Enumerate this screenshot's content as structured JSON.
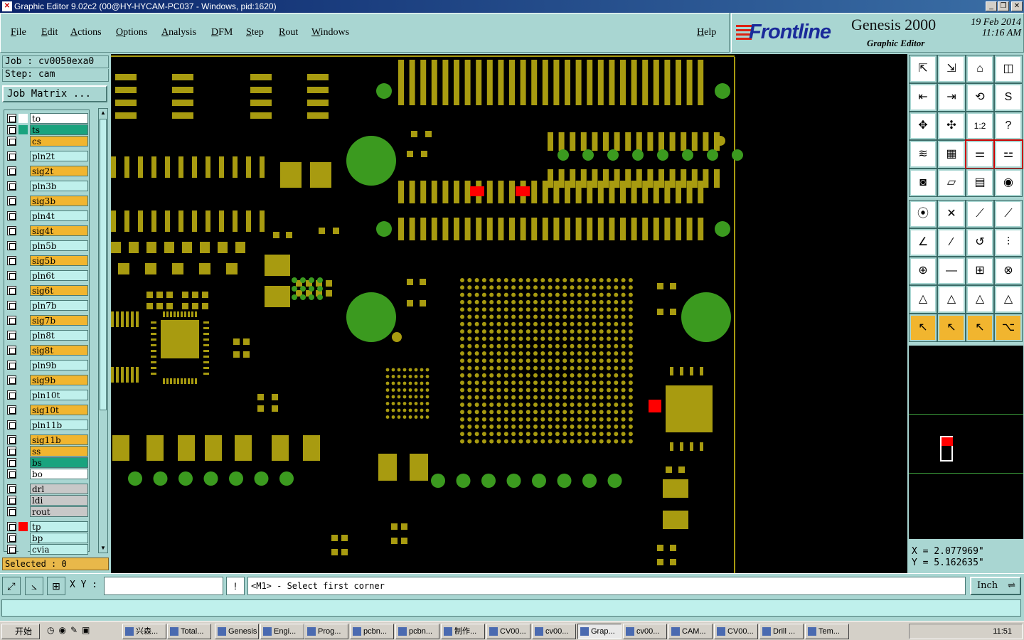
{
  "window": {
    "title": "Graphic Editor 9.02c2 (00@HY-HYCAM-PC037 - Windows, pid:1620)"
  },
  "menu": [
    "File",
    "Edit",
    "Actions",
    "Options",
    "Analysis",
    "DFM",
    "Step",
    "Rout",
    "Windows"
  ],
  "help_label": "Help",
  "brand": {
    "logo": "Frontline",
    "product": "Genesis 2000",
    "subtitle": "Graphic Editor",
    "date": "19 Feb 2014",
    "time": "11:16 AM"
  },
  "job": {
    "label": "Job : cv0050exa0",
    "step": "Step: cam",
    "matrix_button": "Job Matrix ..."
  },
  "layers": [
    {
      "name": "to",
      "color": "#ffffff",
      "check": "#ffffff",
      "mark": "✎"
    },
    {
      "name": "ts",
      "color": "#1aa37e",
      "check": "#1aa37e",
      "mark": ""
    },
    {
      "name": "cs",
      "color": "#f1b52f",
      "check": "#a9d6d2",
      "mark": "✎"
    },
    {
      "name": "pln2t",
      "color": "#bff0ec",
      "check": "#a9d6d2",
      "mark": ""
    },
    {
      "name": "sig2t",
      "color": "#f1b52f",
      "check": "#a9d6d2",
      "mark": "✎"
    },
    {
      "name": "pln3b",
      "color": "#bff0ec",
      "check": "#a9d6d2",
      "mark": ""
    },
    {
      "name": "sig3b",
      "color": "#f1b52f",
      "check": "#a9d6d2",
      "mark": "✎"
    },
    {
      "name": "pln4t",
      "color": "#bff0ec",
      "check": "#a9d6d2",
      "mark": ""
    },
    {
      "name": "sig4t",
      "color": "#f1b52f",
      "check": "#a9d6d2",
      "mark": ""
    },
    {
      "name": "pln5b",
      "color": "#bff0ec",
      "check": "#a9d6d2",
      "mark": ""
    },
    {
      "name": "sig5b",
      "color": "#f1b52f",
      "check": "#a9d6d2",
      "mark": "✎"
    },
    {
      "name": "pln6t",
      "color": "#bff0ec",
      "check": "#a9d6d2",
      "mark": ""
    },
    {
      "name": "sig6t",
      "color": "#f1b52f",
      "check": "#a9d6d2",
      "mark": ""
    },
    {
      "name": "pln7b",
      "color": "#bff0ec",
      "check": "#a9d6d2",
      "mark": ""
    },
    {
      "name": "sig7b",
      "color": "#f1b52f",
      "check": "#a9d6d2",
      "mark": "✎"
    },
    {
      "name": "pln8t",
      "color": "#bff0ec",
      "check": "#a9d6d2",
      "mark": ""
    },
    {
      "name": "sig8t",
      "color": "#f1b52f",
      "check": "#a9d6d2",
      "mark": ""
    },
    {
      "name": "pln9b",
      "color": "#bff0ec",
      "check": "#a9d6d2",
      "mark": ""
    },
    {
      "name": "sig9b",
      "color": "#f1b52f",
      "check": "#a9d6d2",
      "mark": "✎"
    },
    {
      "name": "pln10t",
      "color": "#bff0ec",
      "check": "#a9d6d2",
      "mark": ""
    },
    {
      "name": "sig10t",
      "color": "#f1b52f",
      "check": "#a9d6d2",
      "mark": ""
    },
    {
      "name": "pln11b",
      "color": "#bff0ec",
      "check": "#a9d6d2",
      "mark": ""
    },
    {
      "name": "sig11b",
      "color": "#f1b52f",
      "check": "#a9d6d2",
      "mark": "✎"
    },
    {
      "name": "ss",
      "color": "#f1b52f",
      "check": "#a9d6d2",
      "mark": "✎"
    },
    {
      "name": "bs",
      "color": "#1aa37e",
      "check": "#a9d6d2",
      "mark": ""
    },
    {
      "name": "bo",
      "color": "#ffffff",
      "check": "#a9d6d2",
      "mark": ""
    },
    {
      "name": "drl",
      "color": "#c8c8c8",
      "check": "#a9d6d2",
      "mark": ""
    },
    {
      "name": "ldi",
      "color": "#c8c8c8",
      "check": "#a9d6d2",
      "mark": ""
    },
    {
      "name": "rout",
      "color": "#c8c8c8",
      "check": "#a9d6d2",
      "mark": ""
    },
    {
      "name": "tp",
      "color": "#bff0ec",
      "check": "#ff0000",
      "mark": "▪"
    },
    {
      "name": "bp",
      "color": "#bff0ec",
      "check": "#a9d6d2",
      "mark": ""
    },
    {
      "name": "cvia",
      "color": "#bff0ec",
      "check": "#a9d6d2",
      "mark": ""
    }
  ],
  "selected": "Selected : 0",
  "coords": {
    "x": "X = 2.077969\"",
    "y": "Y = 5.162635\""
  },
  "bottom": {
    "xy_label": "X Y :",
    "xy_value": "",
    "message": "<M1> - Select first corner",
    "unit": "Inch"
  },
  "colors": {
    "pad": "#a89b10",
    "via": "#3b9a1f",
    "highlight": "#ff0000",
    "background": "#000000"
  },
  "taskbar": {
    "start": "开始",
    "items": [
      "兴森...",
      "Total...",
      "Genesis",
      "Engi...",
      "Prog...",
      "pcbn...",
      "pcbn...",
      "制作...",
      "CV00...",
      "cv00...",
      "Grap...",
      "cv00...",
      "CAM...",
      "CV00...",
      "Drill ...",
      "Tem..."
    ],
    "clock": "11:51"
  }
}
